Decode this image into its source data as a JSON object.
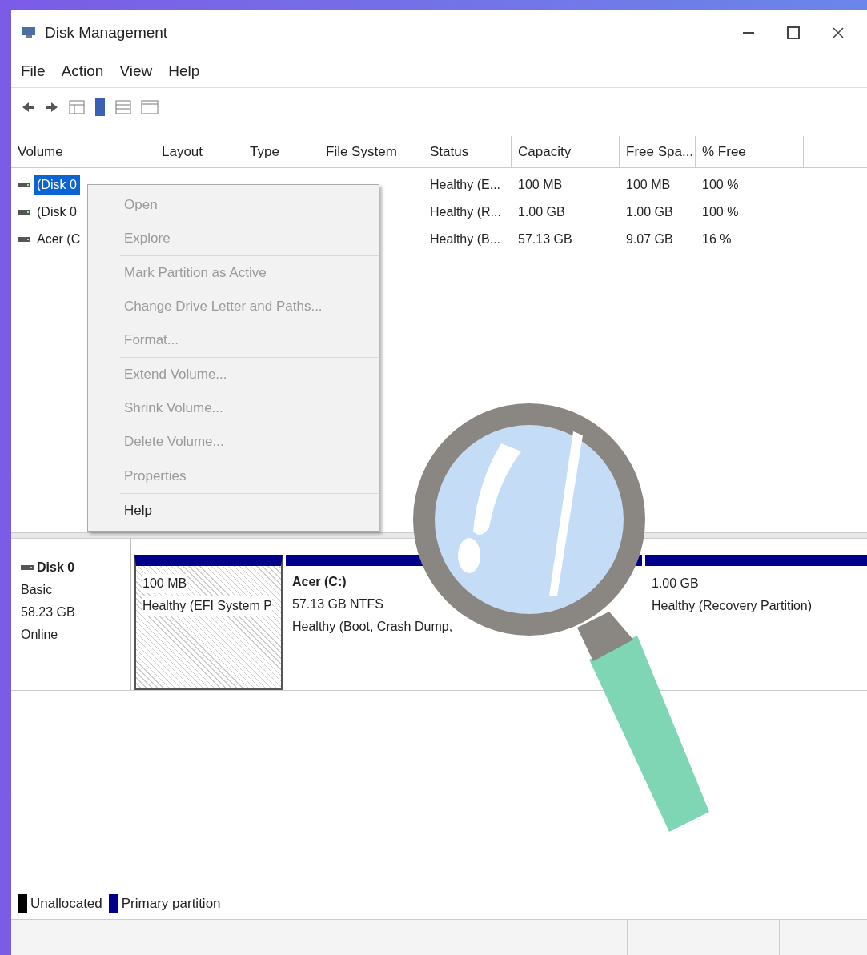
{
  "window": {
    "title": "Disk Management"
  },
  "menu_bar": [
    "File",
    "Action",
    "View",
    "Help"
  ],
  "table": {
    "columns": [
      "Volume",
      "Layout",
      "Type",
      "File System",
      "Status",
      "Capacity",
      "Free Spa...",
      "% Free"
    ],
    "rows": [
      {
        "selected": true,
        "cells": [
          "(Disk 0",
          "",
          "",
          "",
          "Healthy (E...",
          "100 MB",
          "100 MB",
          "100 %"
        ]
      },
      {
        "selected": false,
        "cells": [
          "(Disk 0",
          "",
          "",
          "",
          "Healthy (R...",
          "1.00 GB",
          "1.00 GB",
          "100 %"
        ]
      },
      {
        "selected": false,
        "cells": [
          "Acer (C",
          "",
          "",
          "",
          "Healthy (B...",
          "57.13 GB",
          "9.07 GB",
          "16 %"
        ]
      }
    ]
  },
  "context_menu": {
    "groups": [
      [
        {
          "label": "Open",
          "disabled": true
        },
        {
          "label": "Explore",
          "disabled": true
        }
      ],
      [
        {
          "label": "Mark Partition as Active",
          "disabled": true
        },
        {
          "label": "Change Drive Letter and Paths...",
          "disabled": true
        },
        {
          "label": "Format...",
          "disabled": true
        }
      ],
      [
        {
          "label": "Extend Volume...",
          "disabled": true
        },
        {
          "label": "Shrink Volume...",
          "disabled": true
        },
        {
          "label": "Delete Volume...",
          "disabled": true
        }
      ],
      [
        {
          "label": "Properties",
          "disabled": true
        }
      ],
      [
        {
          "label": "Help",
          "disabled": false
        }
      ]
    ]
  },
  "disk": {
    "name": "Disk 0",
    "lines": [
      "Basic",
      "58.23 GB",
      "Online"
    ],
    "partitions": [
      {
        "selected": true,
        "lines": [
          "100 MB",
          "Healthy (EFI System P"
        ]
      },
      {
        "selected": false,
        "title": "Acer (C:)",
        "lines": [
          "57.13 GB NTFS",
          "Healthy (Boot, Crash Dump,"
        ]
      },
      {
        "selected": false,
        "lines": [
          "1.00 GB",
          "Healthy (Recovery Partition)"
        ]
      }
    ]
  },
  "legend": [
    {
      "label": "Unallocated",
      "color": "#000000"
    },
    {
      "label": "Primary partition",
      "color": "#00008b"
    }
  ]
}
